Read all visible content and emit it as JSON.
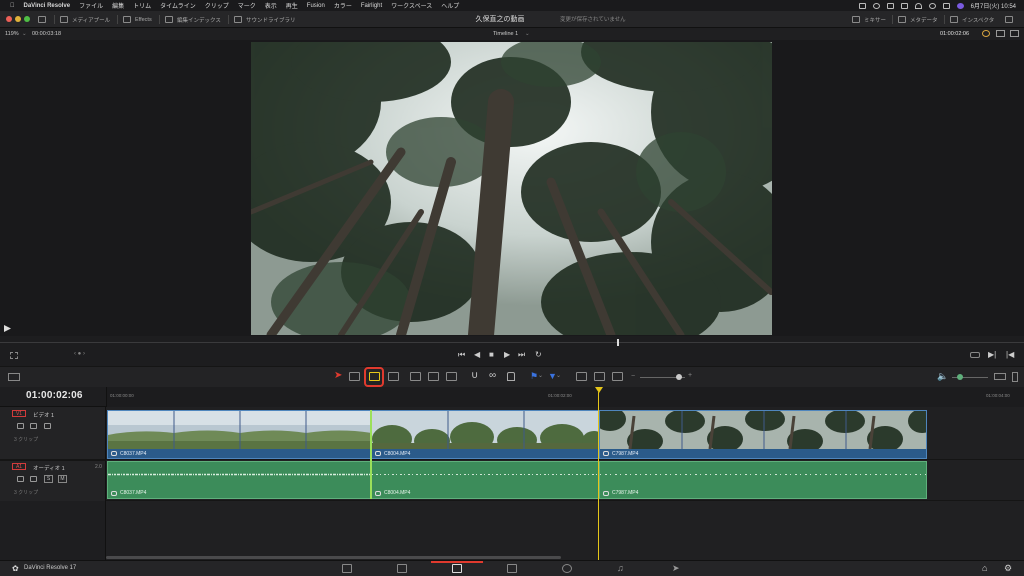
{
  "menubar": {
    "app_name": "DaVinci Resolve",
    "items": [
      "ファイル",
      "編集",
      "トリム",
      "タイムライン",
      "クリップ",
      "マーク",
      "表示",
      "再生",
      "Fusion",
      "カラー",
      "Fairlight",
      "ワークスペース",
      "ヘルプ"
    ],
    "clock": "6月7日(火)  10:54"
  },
  "topbar": {
    "media_pool": "メディアプール",
    "effects": "Effects",
    "edit_index": "編集インデックス",
    "sound_library": "サウンドライブラリ",
    "project_title": "久保直之の動画",
    "save_status": "変更が保存されていません",
    "mixer": "ミキサー",
    "metadata": "メタデータ",
    "inspector": "インスペクタ"
  },
  "viewer": {
    "zoom": "119%",
    "source_timecode": "00:00:03:18",
    "timeline_name": "Timeline 1",
    "record_timecode": "01:00:02:06"
  },
  "timeline": {
    "current_timecode": "01:00:02:06",
    "ruler": [
      "01:00:00:00",
      "01:00:02:00",
      "01:00:04:00"
    ],
    "tracks": {
      "video": {
        "tag": "V1",
        "name": "ビデオ 1",
        "count": "3 クリップ"
      },
      "audio": {
        "tag": "A1",
        "name": "オーディオ 1",
        "channels": "2.0",
        "count": "3 クリップ",
        "solo": "S",
        "mute": "M"
      }
    },
    "video_clips": [
      {
        "name": "C8037.MP4"
      },
      {
        "name": "C8004.MP4"
      },
      {
        "name": "C7987.MP4"
      }
    ],
    "audio_clips": [
      {
        "name": "C8037.MP4"
      },
      {
        "name": "C8004.MP4"
      },
      {
        "name": "C7987.MP4"
      }
    ]
  },
  "footer": {
    "app_version": "DaVinci Resolve 17"
  },
  "colors": {
    "video_clip": "#2b5b8a",
    "audio_clip": "#3c8c5a",
    "playhead": "#e6c619",
    "highlight": "#e03a2e",
    "track_tag": "#d23b3b"
  },
  "icons": {
    "menubar_status": [
      "dropbox-icon",
      "record-icon",
      "keyboard-input-icon",
      "bluetooth-icon",
      "wifi-icon",
      "search-icon",
      "control-center-icon",
      "siri-icon"
    ],
    "toolbar": [
      "selection-arrow-icon",
      "trim-edit-icon",
      "dynamic-trim-icon",
      "blade-icon",
      "insert-clip-icon",
      "overwrite-clip-icon",
      "replace-clip-icon",
      "snapping-icon",
      "linked-selection-icon",
      "position-lock-icon",
      "flag-icon",
      "marker-icon",
      "zoom-icon"
    ],
    "pages": [
      "media-page-icon",
      "cut-page-icon",
      "edit-page-icon",
      "fusion-page-icon",
      "color-page-icon",
      "fairlight-page-icon",
      "deliver-page-icon",
      "home-icon",
      "settings-icon"
    ]
  }
}
